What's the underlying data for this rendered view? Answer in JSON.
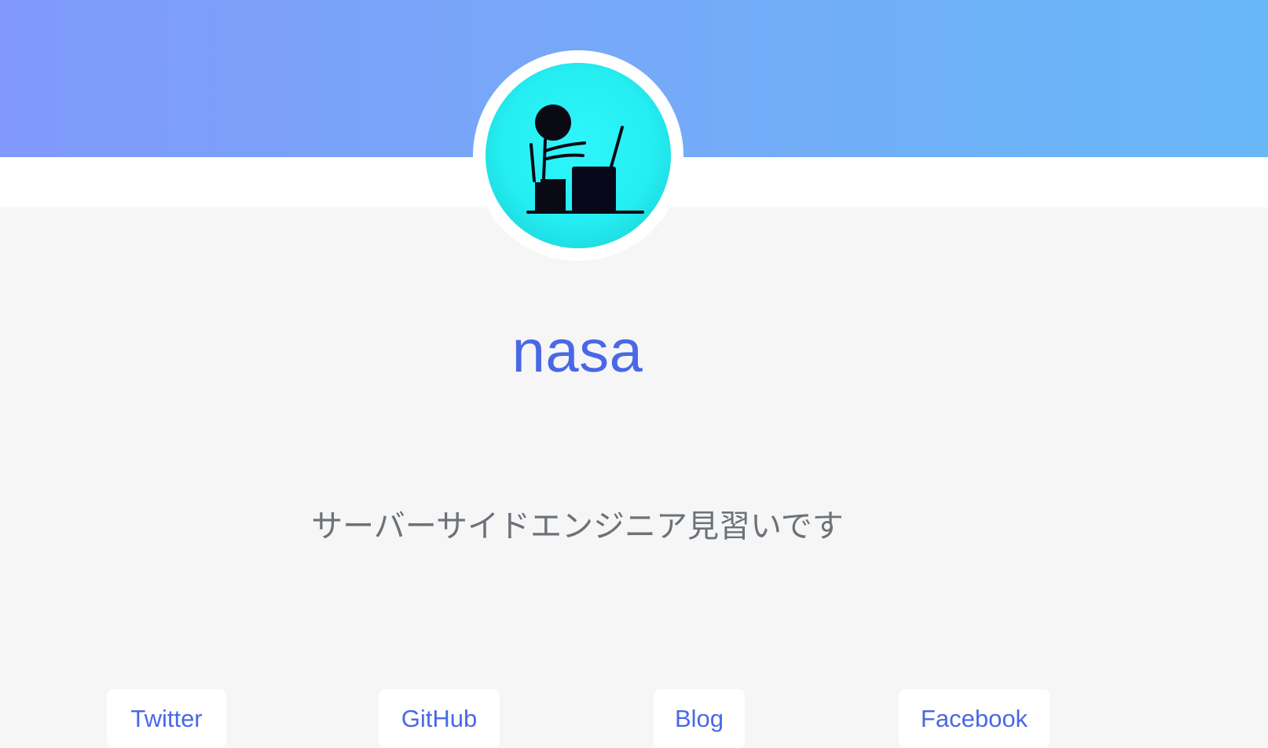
{
  "profile": {
    "name": "nasa",
    "bio": "サーバーサイドエンジニア見習いです",
    "avatar_icon": "person-at-laptop-icon"
  },
  "links": [
    {
      "label": "Twitter"
    },
    {
      "label": "GitHub"
    },
    {
      "label": "Blog"
    },
    {
      "label": "Facebook"
    }
  ],
  "colors": {
    "banner_start": "#8099fb",
    "banner_end": "#68b8f8",
    "accent": "#4a68e6",
    "avatar_bg": "#2ef6fb",
    "bio_text": "#6c7278",
    "page_bg": "#f6f6f6"
  }
}
